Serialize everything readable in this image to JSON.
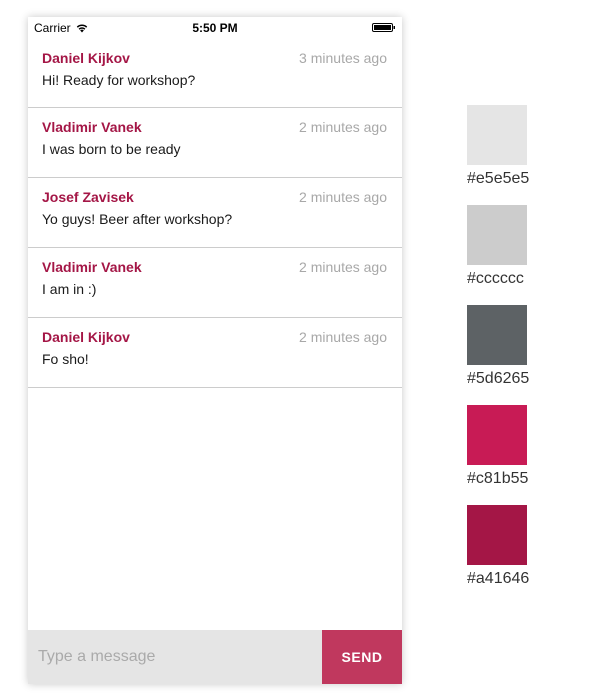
{
  "status_bar": {
    "carrier": "Carrier",
    "time": "5:50 PM"
  },
  "messages": [
    {
      "author": "Daniel Kijkov",
      "time": "3 minutes ago",
      "text": "Hi! Ready for workshop?"
    },
    {
      "author": "Vladimir Vanek",
      "time": "2 minutes ago",
      "text": "I was born to be ready"
    },
    {
      "author": "Josef Zavisek",
      "time": "2 minutes ago",
      "text": "Yo guys! Beer after workshop?"
    },
    {
      "author": "Vladimir Vanek",
      "time": "2 minutes ago",
      "text": "I am in :)"
    },
    {
      "author": "Daniel Kijkov",
      "time": "2 minutes ago",
      "text": "Fo sho!"
    }
  ],
  "composer": {
    "placeholder": "Type a message",
    "send_label": "SEND"
  },
  "palette": [
    {
      "color": "#e5e5e5",
      "label": "#e5e5e5"
    },
    {
      "color": "#cccccc",
      "label": "#cccccc"
    },
    {
      "color": "#5d6265",
      "label": "#5d6265"
    },
    {
      "color": "#c81b55",
      "label": "#c81b55"
    },
    {
      "color": "#a41646",
      "label": "#a41646"
    }
  ]
}
